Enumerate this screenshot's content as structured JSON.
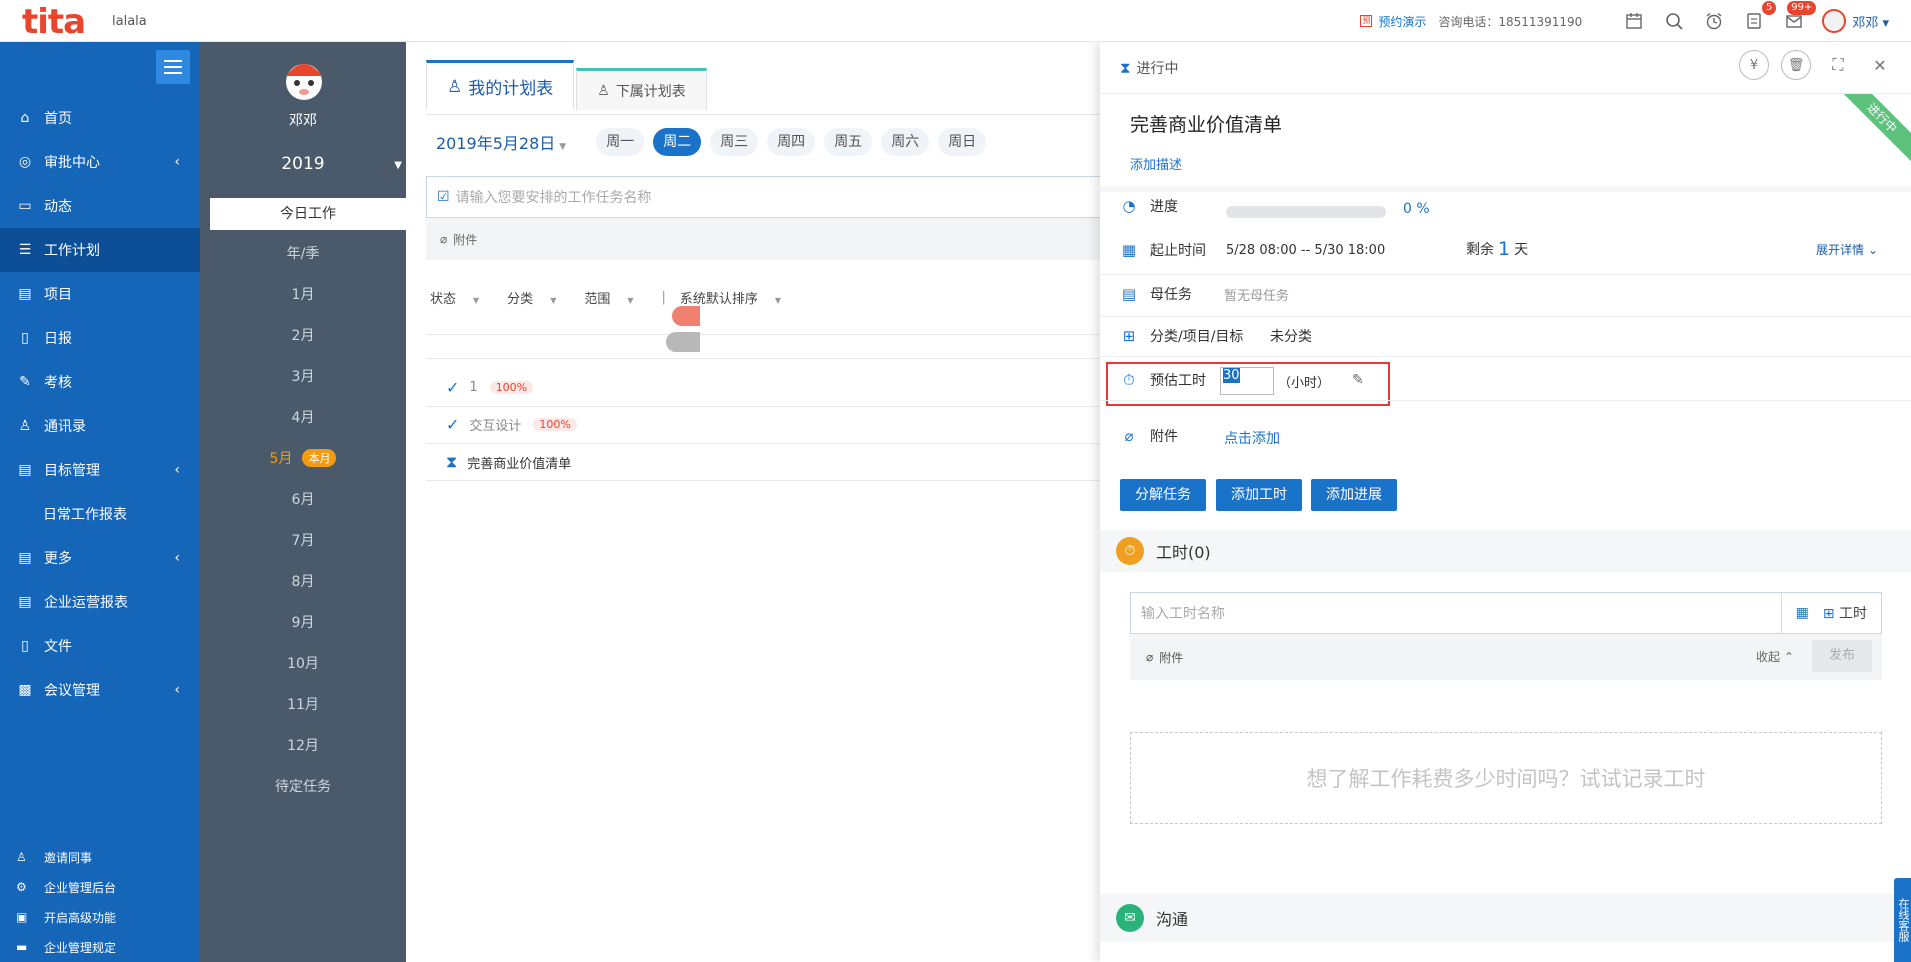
{
  "topbar": {
    "logo": "tita",
    "company": "lalala",
    "demo_label": "预约演示",
    "phone": "咨询电话：18511391190",
    "badge_tasks": "5",
    "badge_messages": "99+",
    "username": "邓邓"
  },
  "nav": {
    "items": [
      {
        "label": "首页"
      },
      {
        "label": "审批中心"
      },
      {
        "label": "动态"
      },
      {
        "label": "工作计划"
      },
      {
        "label": "项目"
      },
      {
        "label": "日报"
      },
      {
        "label": "考核"
      },
      {
        "label": "通讯录"
      },
      {
        "label": "目标管理"
      },
      {
        "label": "日常工作报表"
      },
      {
        "label": "更多"
      },
      {
        "label": "企业运营报表"
      },
      {
        "label": "文件"
      },
      {
        "label": "会议管理"
      }
    ],
    "bottom": [
      {
        "label": "邀请同事"
      },
      {
        "label": "企业管理后台"
      },
      {
        "label": "开启高级功能"
      },
      {
        "label": "企业管理规定"
      }
    ]
  },
  "month_panel": {
    "name": "邓邓",
    "year": "2019",
    "today": "今日工作",
    "items": [
      "年/季",
      "1月",
      "2月",
      "3月",
      "4月",
      "5月",
      "6月",
      "7月",
      "8月",
      "9月",
      "10月",
      "11月",
      "12月",
      "待定任务"
    ],
    "current_badge": "本月"
  },
  "main": {
    "tabs": [
      {
        "label": "我的计划表"
      },
      {
        "label": "下属计划表"
      }
    ],
    "date": "2019年5月28日",
    "days": [
      "周一",
      "周二",
      "周三",
      "周四",
      "周五",
      "周六",
      "周日"
    ],
    "task_placeholder": "请输入您要安排的工作任务名称",
    "attach": "附件",
    "filters": [
      "状态",
      "分类",
      "范围",
      "系统默认排序"
    ],
    "tasks": [
      {
        "name": "1",
        "pct": "100%"
      },
      {
        "name": "交互设计",
        "pct": "100%"
      },
      {
        "name": "完善商业价值清单"
      }
    ]
  },
  "panel": {
    "status": "进行中",
    "ribbon": "进行中",
    "title": "完善商业价值清单",
    "add_desc": "添加描述",
    "progress_label": "进度",
    "progress_value": 0,
    "progress_text": "0 %",
    "time_label": "起止时间",
    "time_value": "5/28 08:00 -- 5/30 18:00",
    "remain_prefix": "剩余",
    "remain_num": "1",
    "remain_suffix": "天",
    "expand": "展开详情",
    "parent_label": "母任务",
    "parent_value": "暂无母任务",
    "category_label": "分类/项目/目标",
    "category_value": "未分类",
    "estimate_label": "预估工时",
    "estimate_value": "30",
    "estimate_unit": "（小时）",
    "attach_label": "附件",
    "attach_action": "点击添加",
    "buttons": [
      "分解任务",
      "添加工时",
      "添加进展"
    ],
    "workhours_title": "工时(0)",
    "workhours_placeholder": "输入工时名称",
    "workhours_add": "工时",
    "wh_attach": "附件",
    "collapse": "收起",
    "publish": "发布",
    "empty_hint": "想了解工作耗费多少时间吗？试试记录工时",
    "comm_title": "沟通",
    "online": "在线客服"
  },
  "colors": {
    "nav_bg": "#1565b8",
    "accent": "#1a73c8",
    "ribbon": "#5cc27c",
    "highlight": "#e53935"
  }
}
